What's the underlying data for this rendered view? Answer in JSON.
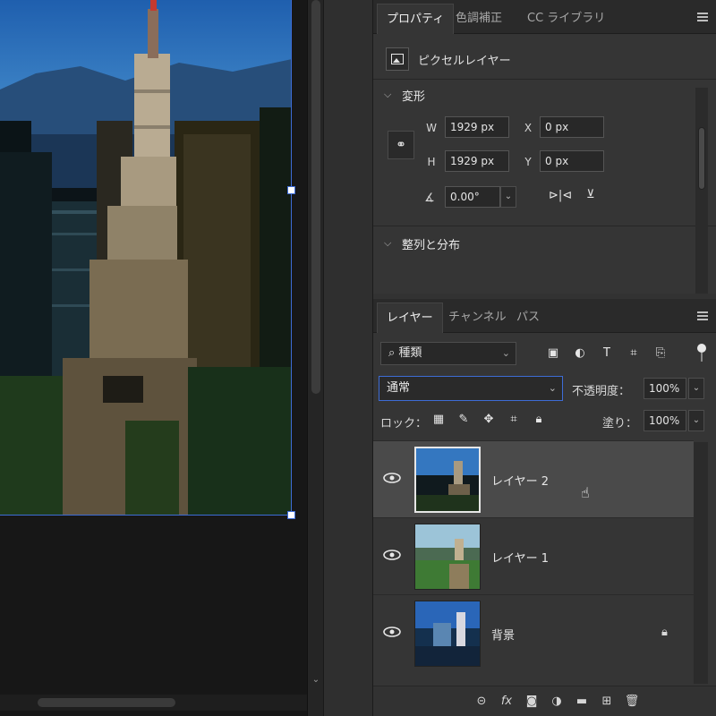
{
  "properties_panel": {
    "tabs": [
      "プロパティ",
      "色調補正",
      "CC ライブラリ"
    ],
    "layer_kind": "ピクセルレイヤー",
    "transform": {
      "section_title": "変形",
      "w_label": "W",
      "w_value": "1929 px",
      "h_label": "H",
      "h_value": "1929 px",
      "x_label": "X",
      "x_value": "0 px",
      "y_label": "Y",
      "y_value": "0 px",
      "angle_value": "0.00°"
    },
    "align_section_title": "整列と分布"
  },
  "layers_panel": {
    "tabs": [
      "レイヤー",
      "チャンネル",
      "パス"
    ],
    "filter_kind": "種類",
    "blend_mode": "通常",
    "opacity_label": "不透明度：",
    "opacity_value": "100%",
    "lock_label": "ロック：",
    "fill_label": "塗り：",
    "fill_value": "100%",
    "layers": [
      {
        "name": "レイヤー 2",
        "selected": true,
        "visible": true,
        "locked": false
      },
      {
        "name": "レイヤー 1",
        "selected": false,
        "visible": true,
        "locked": false
      },
      {
        "name": "背景",
        "selected": false,
        "visible": true,
        "locked": true
      }
    ],
    "bottom_icons": [
      "link-icon",
      "fx-icon",
      "mask-icon",
      "adjustment-icon",
      "folder-icon",
      "new-layer-icon",
      "trash-icon"
    ],
    "filter_icons": [
      "image-filter-icon",
      "adjustment-filter-icon",
      "type-filter-icon",
      "shape-filter-icon",
      "smart-object-filter-icon"
    ],
    "lock_icons": [
      "lock-transparency-icon",
      "lock-paint-icon",
      "lock-position-icon",
      "lock-artboard-icon",
      "lock-all-icon"
    ]
  },
  "colors": {
    "panel_bg": "#353535",
    "selection_blue": "#3d6cd6",
    "selected_row": "#4a4a4a"
  }
}
